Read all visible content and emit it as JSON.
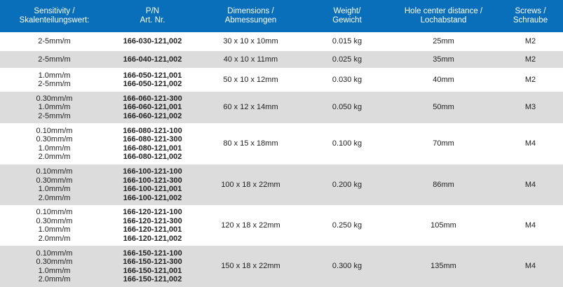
{
  "headers": [
    [
      "Sensitivity /",
      "Skalenteilungswert:"
    ],
    [
      "P/N",
      "Art. Nr."
    ],
    [
      "Dimensions /",
      "Abmessungen"
    ],
    [
      "Weight/",
      "Gewicht"
    ],
    [
      "Hole center distance /",
      "Lochabstand"
    ],
    [
      "Screws /",
      "Schraube"
    ]
  ],
  "rows": [
    {
      "sensitivity": [
        "2-5mm/m"
      ],
      "pn": [
        "166-030-121,002"
      ],
      "dimensions": "30 x 10 x 10mm",
      "weight": "0.015 kg",
      "hole": "25mm",
      "screws": "M2"
    },
    {
      "sensitivity": [
        "2-5mm/m"
      ],
      "pn": [
        "166-040-121,002"
      ],
      "dimensions": "40 x 10 x 11mm",
      "weight": "0.025 kg",
      "hole": "35mm",
      "screws": "M2"
    },
    {
      "sensitivity": [
        "1.0mm/m",
        "2-5mm/m"
      ],
      "pn": [
        "166-050-121,001",
        "166-050-121,002"
      ],
      "dimensions": "50 x 10 x 12mm",
      "weight": "0.030 kg",
      "hole": "40mm",
      "screws": "M2"
    },
    {
      "sensitivity": [
        "0.30mm/m",
        "1.0mm/m",
        "2-5mm/m"
      ],
      "pn": [
        "166-060-121-300",
        "166-060-121,001",
        "166-060-121,002"
      ],
      "dimensions": "60 x 12 x 14mm",
      "weight": "0.050 kg",
      "hole": "50mm",
      "screws": "M3"
    },
    {
      "sensitivity": [
        "0.10mm/m",
        "0.30mm/m",
        "1.0mm/m",
        "2.0mm/m"
      ],
      "pn": [
        "166-080-121-100",
        "166-080-121-300",
        "166-080-121,001",
        "166-080-121,002"
      ],
      "dimensions": "80 x 15 x 18mm",
      "weight": "0.100 kg",
      "hole": "70mm",
      "screws": "M4"
    },
    {
      "sensitivity": [
        "0.10mm/m",
        "0.30mm/m",
        "1.0mm/m",
        "2.0mm/m"
      ],
      "pn": [
        "166-100-121-100",
        "166-100-121-300",
        "166-100-121,001",
        "166-100-121,002"
      ],
      "dimensions": "100 x 18 x 22mm",
      "weight": "0.200 kg",
      "hole": "86mm",
      "screws": "M4"
    },
    {
      "sensitivity": [
        "0.10mm/m",
        "0.30mm/m",
        "1.0mm/m",
        "2.0mm/m"
      ],
      "pn": [
        "166-120-121-100",
        "166-120-121-300",
        "166-120-121,001",
        "166-120-121,002"
      ],
      "dimensions": "120 x 18 x 22mm",
      "weight": "0.250 kg",
      "hole": "105mm",
      "screws": "M4"
    },
    {
      "sensitivity": [
        "0.10mm/m",
        "0.30mm/m",
        "1.0mm/m",
        "2.0mm/m"
      ],
      "pn": [
        "166-150-121-100",
        "166-150-121-300",
        "166-150-121,001",
        "166-150-121,002"
      ],
      "dimensions": "150 x 18 x 22mm",
      "weight": "0.300 kg",
      "hole": "135mm",
      "screws": "M4"
    }
  ],
  "colors": {
    "header_bg": "#0a6fba",
    "alt_row": "#dcdcdc"
  }
}
